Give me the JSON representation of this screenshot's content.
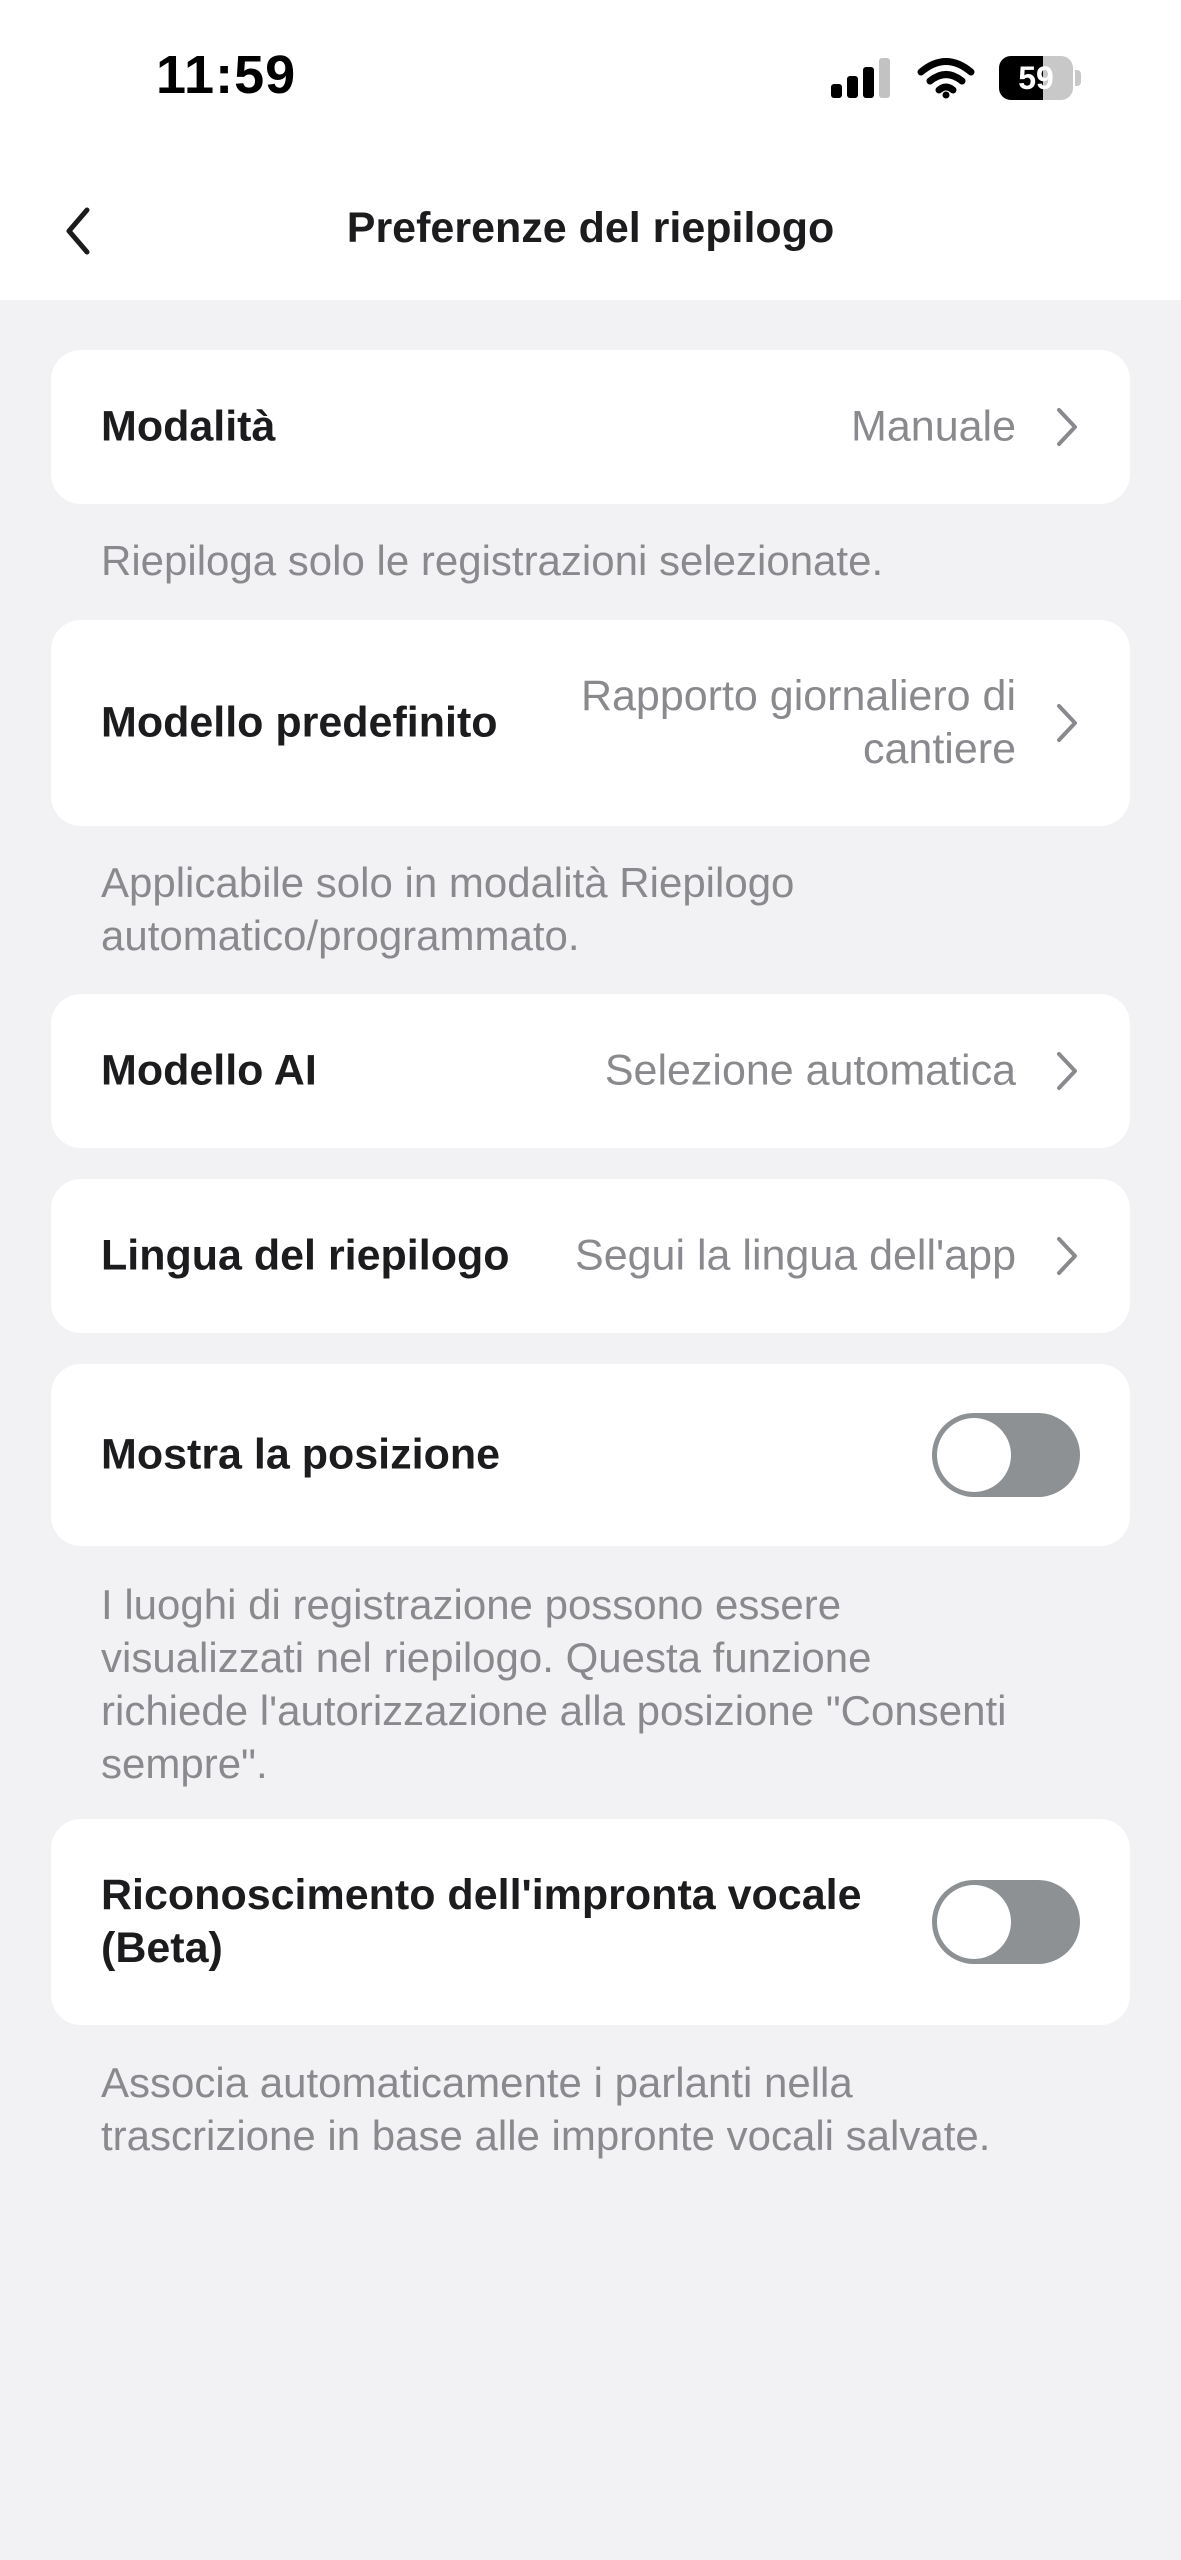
{
  "status_bar": {
    "time": "11:59",
    "battery": "59",
    "battery_fraction": 0.59
  },
  "nav": {
    "back_icon": "chevron-left-icon",
    "title": "Preferenze del riepilogo"
  },
  "settings": {
    "mode": {
      "label": "Modalità",
      "value": "Manuale",
      "note": "Riepiloga solo le registrazioni selezionate."
    },
    "default_template": {
      "label": "Modello predefinito",
      "value_line1": "Rapporto giornaliero di",
      "value_line2": "cantiere",
      "note_line1": "Applicabile solo in modalità Riepilogo",
      "note_line2": "automatico/programmato."
    },
    "ai_model": {
      "label": "Modello AI",
      "value": "Selezione automatica"
    },
    "summary_language": {
      "label": "Lingua del riepilogo",
      "value": "Segui la lingua dell'app"
    },
    "show_location": {
      "label": "Mostra la posizione",
      "enabled": false,
      "note_line1": "I luoghi di registrazione possono essere",
      "note_line2": "visualizzati nel riepilogo. Questa funzione",
      "note_line3": "richiede l'autorizzazione alla posizione \"Consenti",
      "note_line4": "sempre\"."
    },
    "voiceprint": {
      "label_line1": "Riconoscimento dell'impronta vocale",
      "label_line2": "(Beta)",
      "enabled": false,
      "note_line1": "Associa automaticamente i parlanti nella",
      "note_line2": "trascrizione in base alle impronte vocali salvate."
    }
  },
  "colors": {
    "background": "#f2f2f5",
    "card": "#ffffff",
    "secondary_text": "#8a8a8e",
    "toggle_off": "#8d9193"
  }
}
